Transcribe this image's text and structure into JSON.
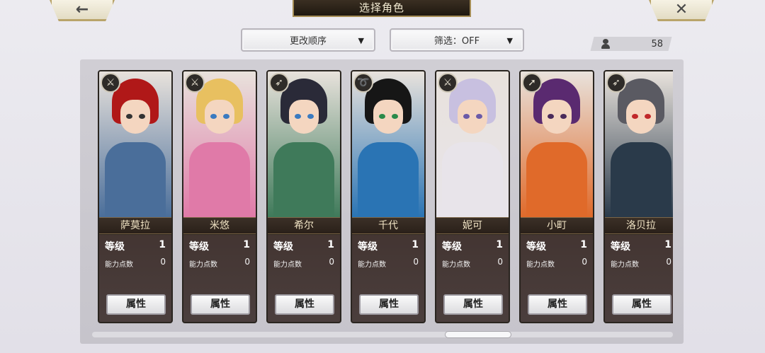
{
  "header": {
    "back_icon": "←",
    "title": "选择角色",
    "close_icon": "✕"
  },
  "controls": {
    "order_label": "更改顺序",
    "filter_label": "筛选：OFF",
    "arrow": "▼",
    "count": "58"
  },
  "cards": [
    {
      "name": "萨莫拉",
      "level_label": "等级",
      "level": "1",
      "points_label": "能力点数",
      "points": "0",
      "button": "属性",
      "class_icon": "sword-icon",
      "class_glyph": "⚔",
      "hair": "#b01818",
      "body": "#4a6e9a",
      "eyes": "#333"
    },
    {
      "name": "米悠",
      "level_label": "等级",
      "level": "1",
      "points_label": "能力点数",
      "points": "0",
      "button": "属性",
      "class_icon": "sword-icon",
      "class_glyph": "⚔",
      "hair": "#e8c060",
      "body": "#e07aa8",
      "eyes": "#3a7ac0"
    },
    {
      "name": "希尔",
      "level_label": "等级",
      "level": "1",
      "points_label": "能力点数",
      "points": "0",
      "button": "属性",
      "class_icon": "bow-icon",
      "class_glyph": "➶",
      "hair": "#2a2a38",
      "body": "#3f7a5a",
      "eyes": "#3a7ac0"
    },
    {
      "name": "千代",
      "level_label": "等级",
      "level": "1",
      "points_label": "能力点数",
      "points": "0",
      "button": "属性",
      "class_icon": "whip-icon",
      "class_glyph": "➰",
      "hair": "#161616",
      "body": "#2a74b4",
      "eyes": "#2a8a4a"
    },
    {
      "name": "妮可",
      "level_label": "等级",
      "level": "1",
      "points_label": "能力点数",
      "points": "0",
      "button": "属性",
      "class_icon": "sword-icon",
      "class_glyph": "⚔",
      "hair": "#c8c0e0",
      "body": "#e8e4ea",
      "eyes": "#6a5aa8"
    },
    {
      "name": "小町",
      "level_label": "等级",
      "level": "1",
      "points_label": "能力点数",
      "points": "0",
      "button": "属性",
      "class_icon": "spear-icon",
      "class_glyph": "➚",
      "hair": "#5a2a70",
      "body": "#e06a2a",
      "eyes": "#4a2a5a"
    },
    {
      "name": "洛贝拉",
      "level_label": "等级",
      "level": "1",
      "points_label": "能力点数",
      "points": "0",
      "button": "属性",
      "class_icon": "bow-icon",
      "class_glyph": "➶",
      "hair": "#5a5a62",
      "body": "#2a3a4a",
      "eyes": "#c0282a"
    }
  ]
}
